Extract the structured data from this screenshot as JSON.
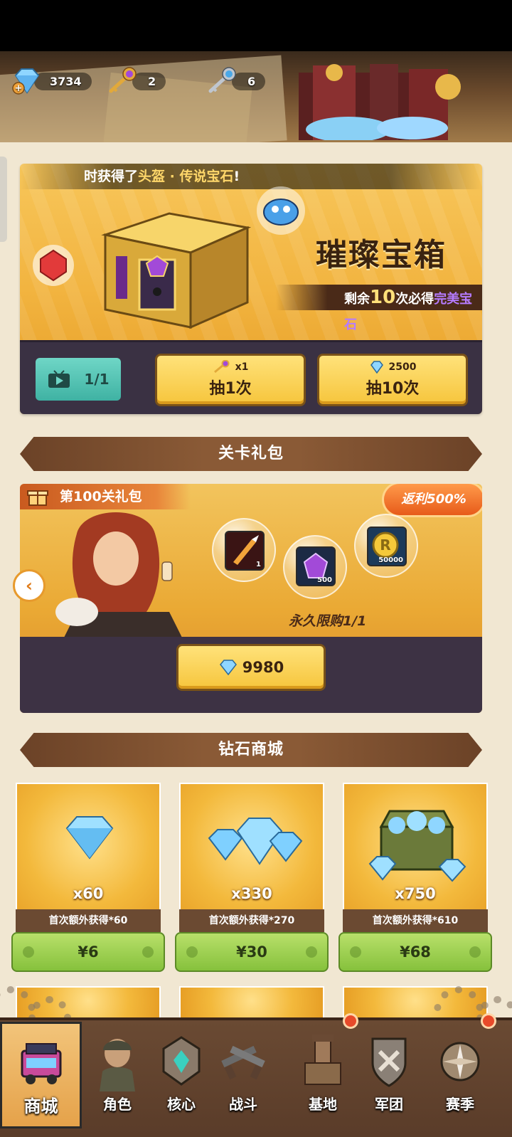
{
  "resources": {
    "diamonds": "3734",
    "purple_keys": "2",
    "blue_keys": "6"
  },
  "chest": {
    "ticker_prefix": "时获得了",
    "ticker_highlight": "头盔 · 传说宝石",
    "ticker_suffix": "!",
    "title": "璀璨宝箱",
    "remain_prefix": "剩余",
    "remain_count": "10",
    "remain_mid": "次必得",
    "remain_reward": "完美宝石",
    "video_count": "1/1",
    "draw1_cost": "x1",
    "draw1_label": "抽1次",
    "draw10_cost": "2500",
    "draw10_label": "抽10次"
  },
  "stage_pack": {
    "section_title": "关卡礼包",
    "pack_name": "第100关礼包",
    "rebate": "返利500%",
    "items": [
      {
        "icon": "weapon-icon",
        "count": "1"
      },
      {
        "icon": "purple-gem-icon",
        "count": "500"
      },
      {
        "icon": "coin-icon",
        "count": "50000"
      }
    ],
    "limit": "永久限购1/1",
    "price": "9980"
  },
  "diamond_shop": {
    "section_title": "钻石商城",
    "items": [
      {
        "qty": "x60",
        "bonus": "首次额外获得*60",
        "price": "¥6"
      },
      {
        "qty": "x330",
        "bonus": "首次额外获得*270",
        "price": "¥30"
      },
      {
        "qty": "x750",
        "bonus": "首次额外获得*610",
        "price": "¥68"
      }
    ]
  },
  "nav": {
    "items": [
      {
        "label": "商城"
      },
      {
        "label": "角色"
      },
      {
        "label": "核心"
      },
      {
        "label": "战斗"
      },
      {
        "label": "基地"
      },
      {
        "label": "军团"
      },
      {
        "label": "赛季"
      }
    ]
  },
  "colors": {
    "gold": "#f6c53c",
    "brown": "#6b4227",
    "green": "#86c13c",
    "teal": "#3fb2a3",
    "purple_text": "#b57bff"
  }
}
